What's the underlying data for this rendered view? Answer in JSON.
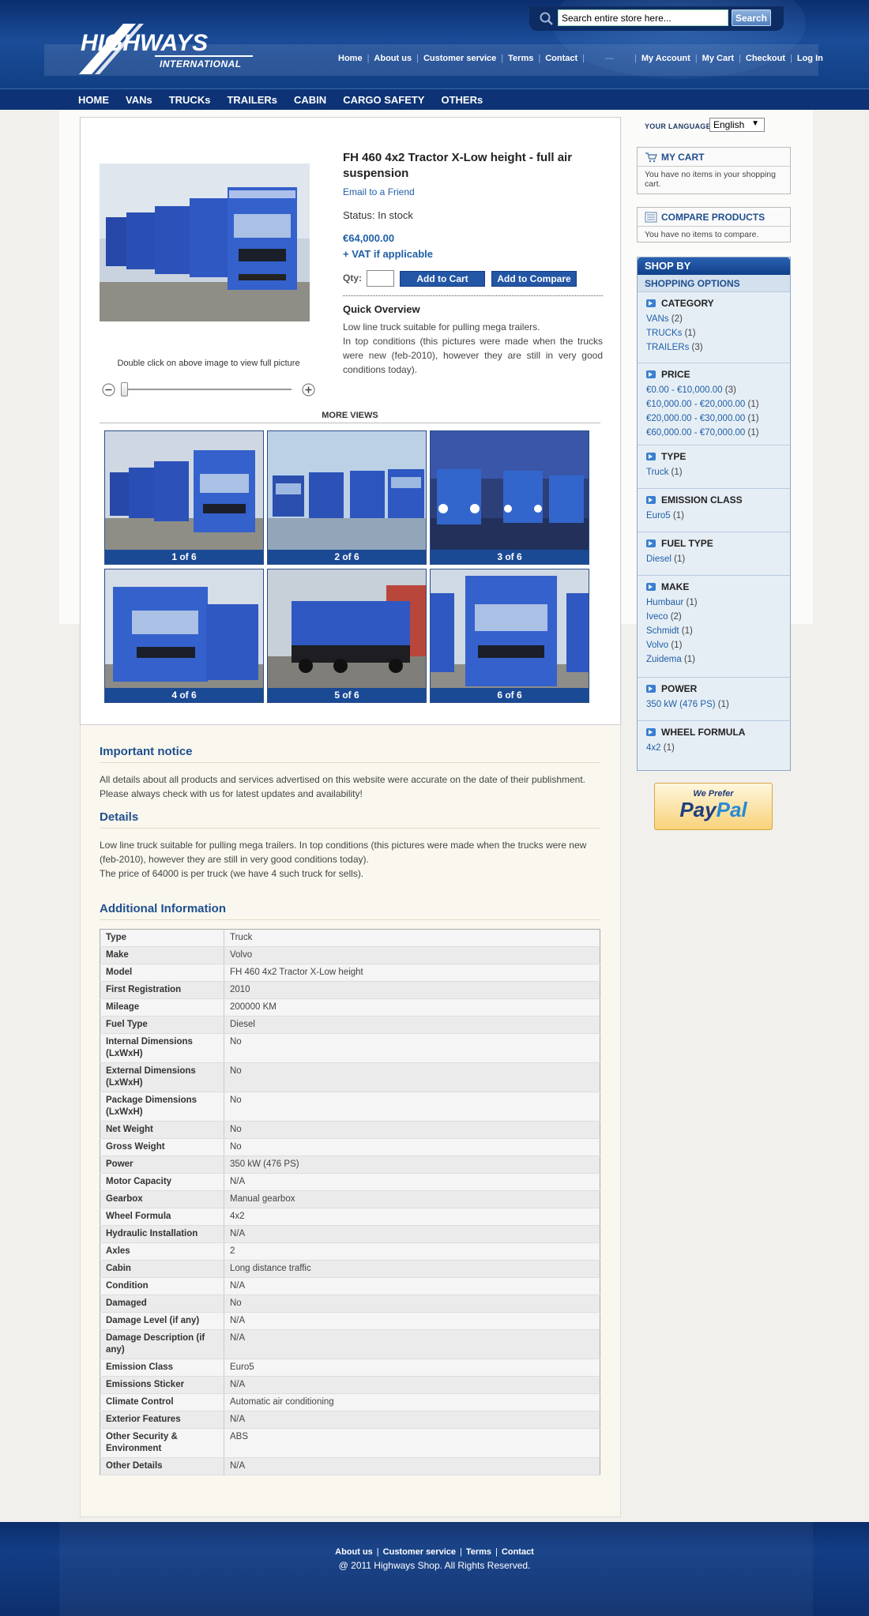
{
  "header": {
    "search_placeholder": "Search entire store here...",
    "search_button": "Search",
    "top_links": [
      "Home",
      "About us",
      "Customer service",
      "Terms",
      "Contact"
    ],
    "account_links": [
      "My Account",
      "My Cart",
      "Checkout",
      "Log In"
    ],
    "logo_text": "HIGHWAYS",
    "logo_subtext": "INTERNATIONAL"
  },
  "nav": [
    "HOME",
    "VANs",
    "TRUCKs",
    "TRAILERs",
    "CABIN",
    "CARGO SAFETY",
    "OTHERs"
  ],
  "product": {
    "name": "FH 460 4x2 Tractor X-Low height - full air suspension",
    "email_friend": "Email to a Friend",
    "status": "Status: In stock",
    "price": "€64,000.00",
    "vat": "+ VAT if applicable",
    "qty_label": "Qty:",
    "add_to_cart": "Add to Cart",
    "add_to_compare": "Add to Compare",
    "overview_title": "Quick Overview",
    "overview_text": "Low line truck suitable for pulling mega trailers.\nIn top conditions (this pictures were made when the trucks were new (feb-2010), however they are still in very good conditions today).",
    "image_caption": "Double click on above image to view full picture",
    "more_views": "MORE VIEWS",
    "thumbs": [
      "1 of 6",
      "2 of 6",
      "3 of 6",
      "4 of 6",
      "5 of 6",
      "6 of 6"
    ]
  },
  "notice": {
    "title": "Important notice",
    "text": "All details about all products and services advertised on this website were accurate on the date of their publishment. Please always check with us for latest updates and availability!"
  },
  "details": {
    "title": "Details",
    "text": "Low line truck suitable for pulling mega trailers. In top conditions (this pictures were made when the trucks were new (feb-2010), however they are still in very good conditions today).\nThe price of 64000 is per truck (we have 4 such truck for sells)."
  },
  "additional": {
    "title": "Additional Information",
    "rows": [
      [
        "Type",
        "Truck"
      ],
      [
        "Make",
        "Volvo"
      ],
      [
        "Model",
        "FH 460 4x2 Tractor X-Low height"
      ],
      [
        "First Registration",
        "2010"
      ],
      [
        "Mileage",
        "200000 KM"
      ],
      [
        "Fuel Type",
        "Diesel"
      ],
      [
        "Internal Dimensions (LxWxH)",
        "No"
      ],
      [
        "External Dimensions (LxWxH)",
        "No"
      ],
      [
        "Package Dimensions (LxWxH)",
        "No"
      ],
      [
        "Net Weight",
        "No"
      ],
      [
        "Gross Weight",
        "No"
      ],
      [
        "Power",
        "350 kW (476 PS)"
      ],
      [
        "Motor Capacity",
        "N/A"
      ],
      [
        "Gearbox",
        "Manual gearbox"
      ],
      [
        "Wheel Formula",
        "4x2"
      ],
      [
        "Hydraulic Installation",
        "N/A"
      ],
      [
        "Axles",
        "2"
      ],
      [
        "Cabin",
        "Long distance traffic"
      ],
      [
        "Condition",
        "N/A"
      ],
      [
        "Damaged",
        "No"
      ],
      [
        "Damage Level (if any)",
        "N/A"
      ],
      [
        "Damage Description (if any)",
        "N/A"
      ],
      [
        "Emission Class",
        "Euro5"
      ],
      [
        "Emissions Sticker",
        "N/A"
      ],
      [
        "Climate Control",
        "Automatic air conditioning"
      ],
      [
        "Exterior Features",
        "N/A"
      ],
      [
        "Other Security & Environment",
        "ABS"
      ],
      [
        "Other Details",
        "N/A"
      ]
    ]
  },
  "sidebar": {
    "language_label": "YOUR LANGUAGE:",
    "language_value": "English",
    "cart_title": "MY CART",
    "cart_text": "You have no items in your shopping cart.",
    "compare_title": "COMPARE PRODUCTS",
    "compare_text": "You have no items to compare.",
    "shopby_title": "SHOP BY",
    "shopping_options": "SHOPPING OPTIONS",
    "filters": [
      {
        "title": "CATEGORY",
        "items": [
          [
            "VANs",
            "(2)"
          ],
          [
            "TRUCKs",
            "(1)"
          ],
          [
            "TRAILERs",
            "(3)"
          ]
        ]
      },
      {
        "title": "PRICE",
        "items": [
          [
            "€0.00 - €10,000.00",
            "(3)"
          ],
          [
            "€10,000.00 - €20,000.00",
            "(1)"
          ],
          [
            "€20,000.00 - €30,000.00",
            "(1)"
          ],
          [
            "€60,000.00 - €70,000.00",
            "(1)"
          ]
        ]
      },
      {
        "title": "TYPE",
        "items": [
          [
            "Truck",
            "(1)"
          ]
        ]
      },
      {
        "title": "EMISSION CLASS",
        "items": [
          [
            "Euro5",
            "(1)"
          ]
        ]
      },
      {
        "title": "FUEL TYPE",
        "items": [
          [
            "Diesel",
            "(1)"
          ]
        ]
      },
      {
        "title": "MAKE",
        "items": [
          [
            "Humbaur",
            "(1)"
          ],
          [
            "Iveco",
            "(2)"
          ],
          [
            "Schmidt",
            "(1)"
          ],
          [
            "Volvo",
            "(1)"
          ],
          [
            "Zuidema",
            "(1)"
          ]
        ]
      },
      {
        "title": "POWER",
        "items": [
          [
            "350 kW (476 PS)",
            "(1)"
          ]
        ]
      },
      {
        "title": "WHEEL FORMULA",
        "items": [
          [
            "4x2",
            "(1)"
          ]
        ]
      }
    ],
    "paypal_top": "We Prefer",
    "paypal_pay": "Pay",
    "paypal_pal": "Pal"
  },
  "footer": {
    "links": [
      "About us",
      "Customer service",
      "Terms",
      "Contact"
    ],
    "copyright": "@ 2011 Highways Shop. All Rights Reserved."
  },
  "colors": {
    "brand_blue": "#1a4c98",
    "nav_blue": "#0d3376",
    "link_blue": "#1f5fa7"
  }
}
